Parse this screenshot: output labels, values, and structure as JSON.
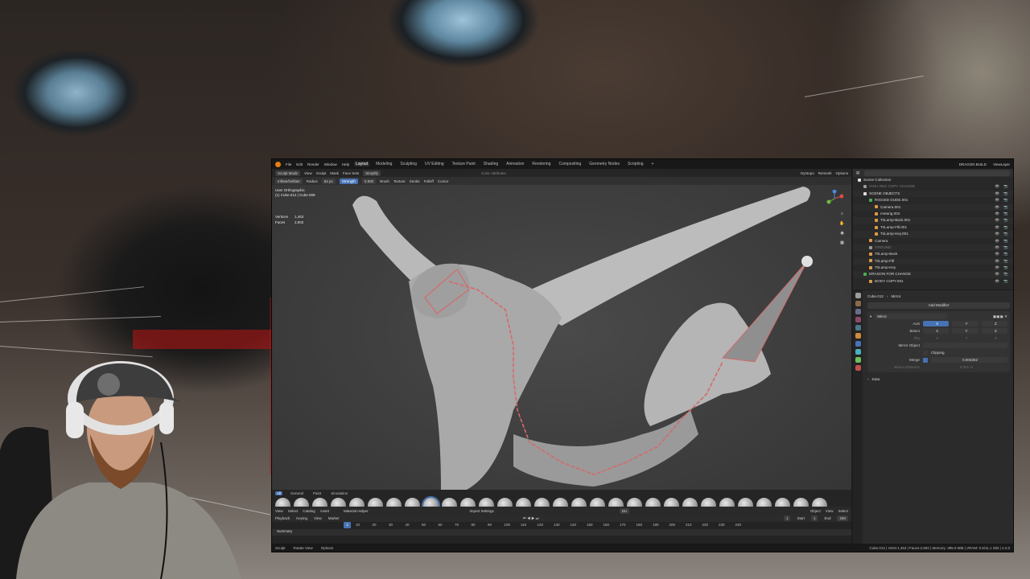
{
  "app": {
    "menus": [
      "File",
      "Edit",
      "Render",
      "Window",
      "Help"
    ],
    "workspaces": [
      "Layout",
      "Modeling",
      "Sculpting",
      "UV Editing",
      "Texture Paint",
      "Shading",
      "Animation",
      "Rendering",
      "Compositing",
      "Geometry Nodes",
      "Scripting"
    ],
    "active_workspace": "Layout",
    "scene_name": "DRAGON BUILD",
    "view_layer": "ViewLayer"
  },
  "viewport": {
    "mode": "Sculpt Mode",
    "header_menus": [
      "View",
      "Sculpt",
      "Mask",
      "Face Sets"
    ],
    "brush_name": "Simplify",
    "tool_settings": {
      "brush_mode": "Inflate/Deflate",
      "radius_label": "Radius",
      "radius_value": "84 px",
      "strength_label": "Strength",
      "strength_value": "0.500",
      "menus": [
        "Brush",
        "Texture",
        "Stroke",
        "Falloff",
        "Cursor"
      ]
    },
    "right_menus": [
      "Dyntopo",
      "Remesh",
      "Options"
    ],
    "color_attributes": "Color Attributes",
    "view_name": "User Orthographic",
    "object_info": "(1) Cube.012 | Cube.009",
    "stats": [
      {
        "label": "Vertices",
        "value": "1,453"
      },
      {
        "label": "Faces",
        "value": "2,902"
      }
    ]
  },
  "brush_shelf": {
    "tabs": [
      "All",
      "General",
      "Paint",
      "Simulation"
    ],
    "active_tab": "All",
    "brush_count": 30,
    "active_index": 8
  },
  "editor_header": {
    "menus": [
      "View",
      "Select",
      "Catalog",
      "Asset"
    ],
    "material_helper": "Material Helper",
    "import_settings": "Import Settings",
    "search_value": "DU",
    "object_menus": [
      "Object",
      "View",
      "Select"
    ]
  },
  "timeline": {
    "menus": [
      "Playback",
      "Keying",
      "View",
      "Marker"
    ],
    "current_frame": "1",
    "start_label": "Start",
    "start": "1",
    "end_label": "End",
    "end": "250",
    "ticks": [
      "10",
      "20",
      "30",
      "40",
      "50",
      "60",
      "70",
      "80",
      "90",
      "100",
      "110",
      "120",
      "130",
      "140",
      "150",
      "160",
      "170",
      "180",
      "190",
      "200",
      "210",
      "220",
      "230",
      "240"
    ],
    "summary": "Summary"
  },
  "status": {
    "left": [
      "Sculpt",
      "Rotate View",
      "Options"
    ],
    "right": "Cube.012 | Verts:1,453 | Faces:2,902 | Memory: 395.9 MiB | VRAM: 0.5/11.1 GiB | 4.2.0"
  },
  "outliner": {
    "header": "Scene Collection",
    "items": [
      {
        "name": "HIGH RES COPY CHANGE",
        "disabled": true,
        "color": "#9a9a9a",
        "indent": 1
      },
      {
        "name": "SCENE OBJECTS",
        "disabled": false,
        "color": "#e0e0e0",
        "indent": 1
      },
      {
        "name": "RIGGED DUDE.001",
        "disabled": false,
        "color": "#4caf50",
        "indent": 2
      },
      {
        "name": "Camera.001",
        "disabled": false,
        "color": "#e09a46",
        "indent": 3
      },
      {
        "name": "metarig.002",
        "disabled": false,
        "color": "#e09a46",
        "indent": 3
      },
      {
        "name": "TriLamp-Back.001",
        "disabled": false,
        "color": "#e09a46",
        "indent": 3
      },
      {
        "name": "TriLamp-Fill.001",
        "disabled": false,
        "color": "#e09a46",
        "indent": 3
      },
      {
        "name": "TriLamp-Key.001",
        "disabled": false,
        "color": "#e09a46",
        "indent": 3
      },
      {
        "name": "Camera",
        "disabled": false,
        "color": "#e09a46",
        "indent": 2
      },
      {
        "name": "GROUND",
        "disabled": true,
        "color": "#9a9a9a",
        "indent": 2
      },
      {
        "name": "TriLamp-Back",
        "disabled": false,
        "color": "#e09a46",
        "indent": 2
      },
      {
        "name": "TriLamp-Fill",
        "disabled": false,
        "color": "#e09a46",
        "indent": 2
      },
      {
        "name": "TriLamp-Key",
        "disabled": false,
        "color": "#e09a46",
        "indent": 2
      },
      {
        "name": "DRAGON FOR CHANGE",
        "disabled": false,
        "color": "#4caf50",
        "indent": 1
      },
      {
        "name": "BODY COPY.001",
        "disabled": false,
        "color": "#e09a46",
        "indent": 2
      }
    ]
  },
  "properties": {
    "object_name": "Cube.012",
    "modifier_breadcrumb": "Mirror",
    "add_modifier": "Add Modifier",
    "modifier_name": "Mirror",
    "rows": [
      {
        "label": "Axis",
        "values": [
          "X",
          "Y",
          "Z"
        ],
        "active": 0
      },
      {
        "label": "Bisect",
        "values": [
          "X",
          "Y",
          "Z"
        ],
        "active": -1
      },
      {
        "label": "Flip",
        "values": [
          "X",
          "Y",
          "Z"
        ],
        "active": -1,
        "dim": true
      }
    ],
    "mirror_object_label": "Mirror Object",
    "mirror_object_value": "",
    "clipping_label": "Clipping",
    "merge_label": "Merge",
    "merge_value": "0.003281'",
    "bisect_distance_label": "Bisect Distance",
    "bisect_distance_value": "0.001 m",
    "data_label": "Data"
  },
  "colors": {
    "accent": "#4772b3",
    "blender_orange": "#e87d0d",
    "armature": "#d46a6a"
  }
}
